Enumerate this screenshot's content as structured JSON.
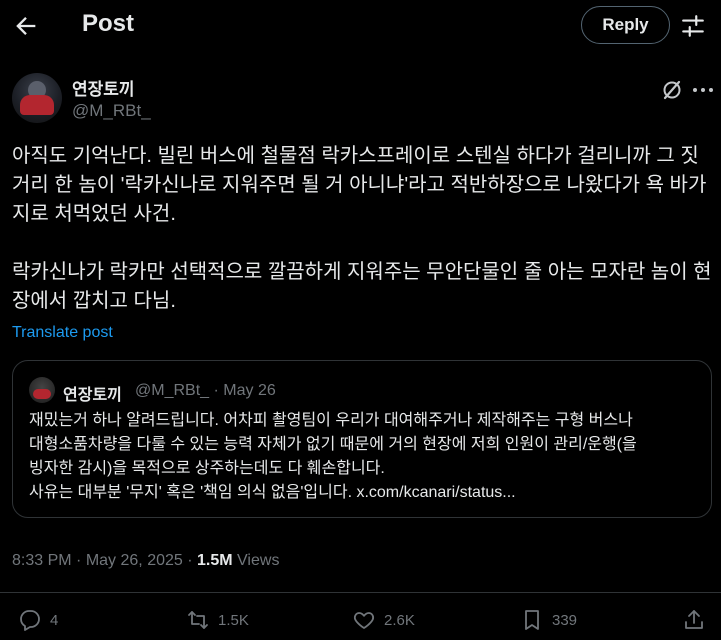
{
  "header": {
    "title": "Post",
    "reply_label": "Reply"
  },
  "author": {
    "name": "연장토끼",
    "handle": "@M_RBt_"
  },
  "post": {
    "paragraphs": [
      "아직도 기억난다. 빌린 버스에 철물점 락카스프레이로 스텐실 하다가 걸리니까 그 짓거리 한 놈이 '락카신나로 지워주면 될 거 아니냐'라고 적반하장으로 나왔다가 욕 바가지로 처먹었던 사건.",
      "락카신나가 락카만 선택적으로 깔끔하게 지워주는 무안단물인 줄 아는 모자란 놈이 현장에서 깝치고 다님."
    ],
    "translate_label": "Translate post",
    "time": "8:33 PM",
    "date": "May 26, 2025",
    "views_count": "1.5M",
    "views_label": "Views"
  },
  "quote": {
    "name": "연장토끼",
    "handle": "@M_RBt_",
    "date": "May 26",
    "lines": [
      "재밌는거 하나 알려드립니다. 어차피 촬영팀이 우리가 대여해주거나 제작해주는 구형 버스나",
      "대형소품차량을 다룰 수 있는 능력 자체가 없기 때문에 거의 현장에 저희 인원이 관리/운행(을",
      "빙자한 감시)을 목적으로 상주하는데도 다 훼손합니다.",
      "사유는 대부분 '무지' 혹은 '책임 의식 없음'입니다. x.com/kcanari/status..."
    ]
  },
  "actions": {
    "replies": "4",
    "reposts": "1.5K",
    "likes": "2.6K",
    "bookmarks": "339"
  },
  "icons": [
    "back-arrow-icon",
    "tune-icon",
    "grok-icon",
    "more-icon",
    "reply-icon",
    "repost-icon",
    "like-icon",
    "bookmark-icon",
    "share-icon"
  ],
  "colors": {
    "background": "#000000",
    "text": "#e7e9ea",
    "muted": "#71767b",
    "link": "#1d9bf0",
    "border": "#2f3336"
  }
}
